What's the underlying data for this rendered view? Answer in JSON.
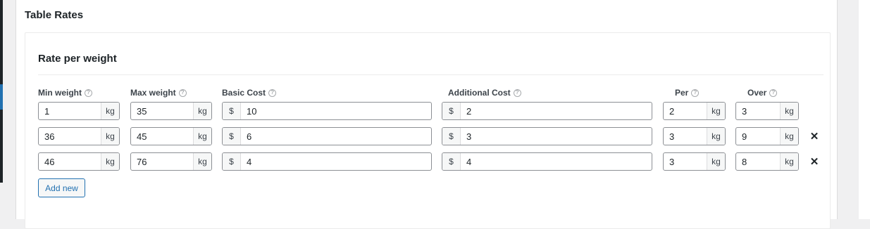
{
  "section": {
    "title": "Table Rates"
  },
  "card": {
    "title": "Rate per weight"
  },
  "columns": {
    "min_weight": "Min weight",
    "max_weight": "Max weight",
    "basic_cost": "Basic Cost",
    "additional_cost": "Additional Cost",
    "per": "Per",
    "over": "Over"
  },
  "help_glyph": "?",
  "units": {
    "weight": "kg",
    "currency": "$"
  },
  "remove_glyph": "✕",
  "rows": [
    {
      "min": "1",
      "max": "35",
      "basic": "10",
      "additional": "2",
      "per": "2",
      "over": "3"
    },
    {
      "min": "36",
      "max": "45",
      "basic": "6",
      "additional": "3",
      "per": "3",
      "over": "9"
    },
    {
      "min": "46",
      "max": "76",
      "basic": "4",
      "additional": "4",
      "per": "3",
      "over": "8"
    }
  ],
  "add_new_label": "Add new"
}
